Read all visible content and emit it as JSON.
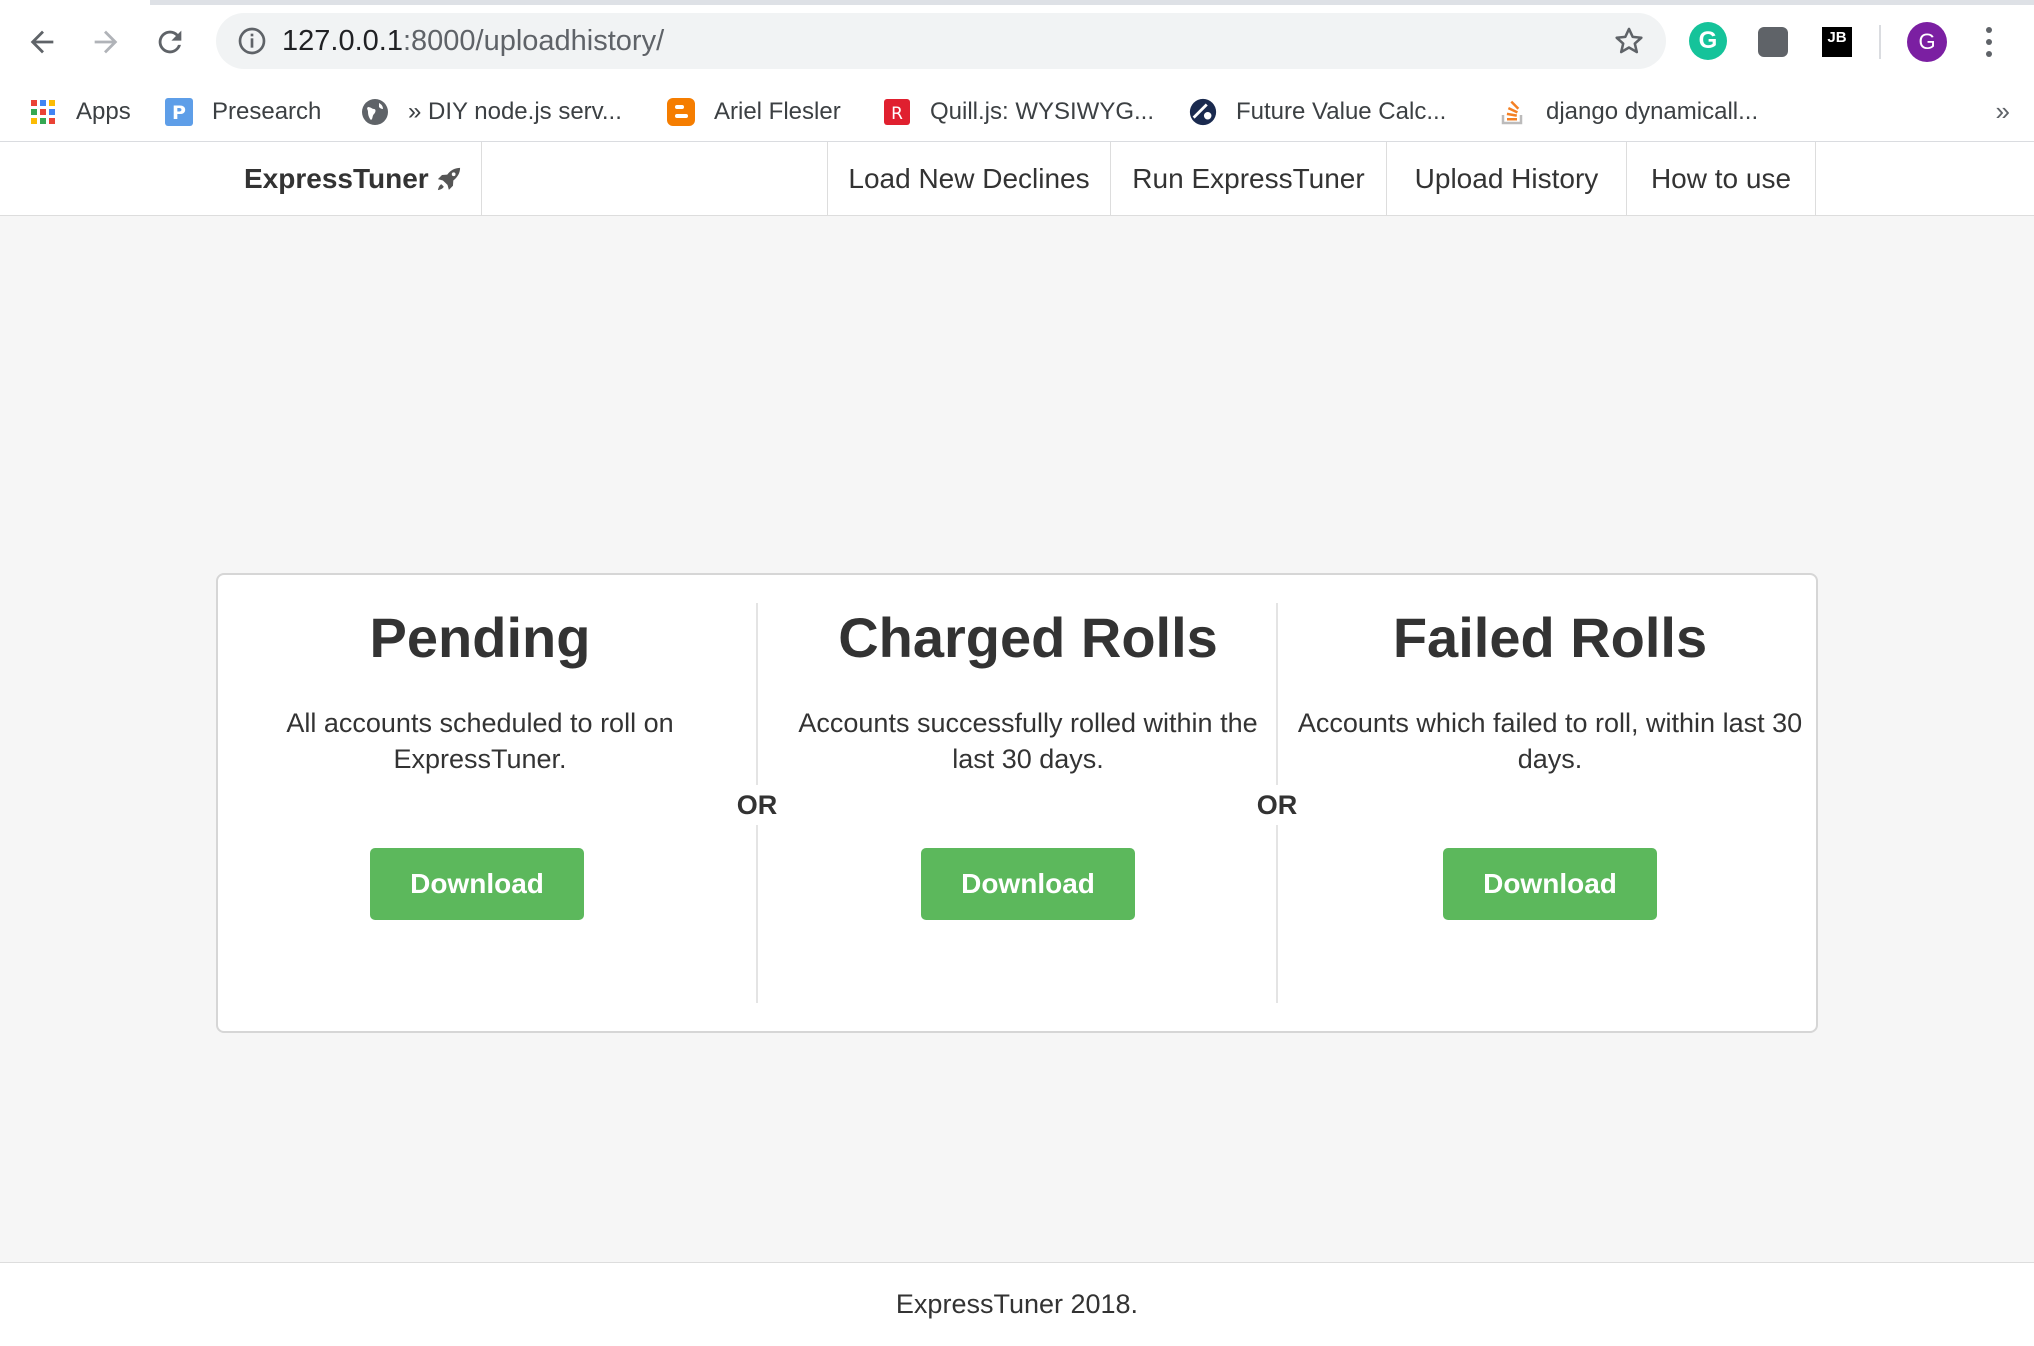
{
  "browser": {
    "url_host": "127.0.0.1",
    "url_rest": ":8000/uploadhistory/",
    "extensions": [
      {
        "name": "grammarly-icon",
        "glyph": "G"
      },
      {
        "name": "extension-square-icon",
        "glyph": ""
      },
      {
        "name": "jetbrains-icon",
        "glyph": "JB"
      }
    ],
    "profile_initial": "G",
    "bookmarks": [
      {
        "label": "Apps",
        "icon": "apps-grid-icon"
      },
      {
        "label": "Presearch",
        "icon": "presearch-icon"
      },
      {
        "label": "» DIY node.js serv...",
        "icon": "globe-icon"
      },
      {
        "label": "Ariel Flesler",
        "icon": "blogger-icon"
      },
      {
        "label": "Quill.js: WYSIWYG...",
        "icon": "quill-icon"
      },
      {
        "label": "Future Value Calc...",
        "icon": "calculator-site-icon"
      },
      {
        "label": "django dynamicall...",
        "icon": "stackoverflow-icon"
      }
    ],
    "bookmarks_more": "»"
  },
  "navbar": {
    "brand": "ExpressTuner",
    "links": [
      "Load New Declines",
      "Run ExpressTuner",
      "Upload History",
      "How to use"
    ]
  },
  "card": {
    "columns": [
      {
        "title": "Pending",
        "description": "All accounts scheduled to roll on ExpressTuner.",
        "button": "Download"
      },
      {
        "title": "Charged Rolls",
        "description": "Accounts successfully rolled within the last 30 days.",
        "button": "Download"
      },
      {
        "title": "Failed Rolls",
        "description": "Accounts which failed to roll, within last 30 days.",
        "button": "Download"
      }
    ],
    "separator": "OR"
  },
  "footer": {
    "text": "ExpressTuner 2018."
  },
  "colors": {
    "button_green": "#5cb85c",
    "page_bg": "#f6f6f6",
    "profile_purple": "#7b1fa2",
    "grammarly_green": "#15c39a"
  }
}
